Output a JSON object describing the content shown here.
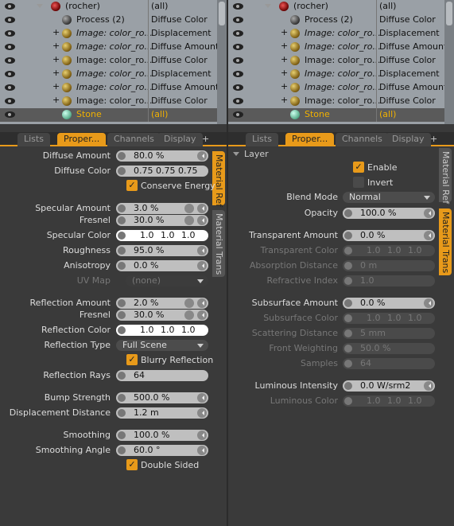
{
  "tree": {
    "rows": [
      {
        "name": "(rocher)",
        "effect": "(all)"
      },
      {
        "name": "Process (2)",
        "effect": "Diffuse Color"
      },
      {
        "name": "Image: color_ro...",
        "effect": "Displacement"
      },
      {
        "name": "Image: color_ro...",
        "effect": "Diffuse Amount"
      },
      {
        "name": "Image: color_ro...",
        "effect": "Diffuse Color"
      },
      {
        "name": "Image: color_ro...",
        "effect": "Displacement"
      },
      {
        "name": "Image: color_ro...",
        "effect": "Diffuse Amount"
      },
      {
        "name": "Image: color_ro...",
        "effect": "Diffuse Color"
      },
      {
        "name": "Stone",
        "effect": "(all)"
      }
    ]
  },
  "tabs": {
    "lists": "Lists",
    "properties": "Proper...",
    "channels": "Channels",
    "display": "Display",
    "add": "+"
  },
  "left": {
    "vtabs": {
      "material_ref": "Material Ref",
      "material_trans": "Material Trans"
    },
    "diffuse_amount": {
      "label": "Diffuse Amount",
      "value": "80.0 %"
    },
    "diffuse_color": {
      "label": "Diffuse Color",
      "value": "0.75 0.75 0.75"
    },
    "conserve_energy": {
      "label": "Conserve Energy",
      "check": "✓"
    },
    "specular_amount": {
      "label": "Specular Amount",
      "value": "3.0 %"
    },
    "fresnel": {
      "label": "Fresnel",
      "value": "30.0 %"
    },
    "specular_color": {
      "label": "Specular Color",
      "r": "1.0",
      "g": "1.0",
      "b": "1.0"
    },
    "roughness": {
      "label": "Roughness",
      "value": "95.0 %"
    },
    "anisotropy": {
      "label": "Anisotropy",
      "value": "0.0 %"
    },
    "uv_map": {
      "label": "UV Map",
      "value": "(none)"
    },
    "reflection_amount": {
      "label": "Reflection Amount",
      "value": "2.0 %"
    },
    "fresnel2": {
      "label": "Fresnel",
      "value": "30.0 %"
    },
    "reflection_color": {
      "label": "Reflection Color",
      "r": "1.0",
      "g": "1.0",
      "b": "1.0"
    },
    "reflection_type": {
      "label": "Reflection Type",
      "value": "Full Scene"
    },
    "blurry_reflection": {
      "label": "Blurry Reflection",
      "check": "✓"
    },
    "reflection_rays": {
      "label": "Reflection Rays",
      "value": "64"
    },
    "bump_strength": {
      "label": "Bump Strength",
      "value": "500.0 %"
    },
    "displacement_distance": {
      "label": "Displacement Distance",
      "value": "1.2 m"
    },
    "smoothing": {
      "label": "Smoothing",
      "value": "100.0 %"
    },
    "smoothing_angle": {
      "label": "Smoothing Angle",
      "value": "60.0 °"
    },
    "double_sided": {
      "label": "Double Sided",
      "check": "✓"
    }
  },
  "right": {
    "vtabs": {
      "material_ref": "Material Ref",
      "material_trans": "Material Trans"
    },
    "layer": "Layer",
    "enable": {
      "label": "Enable",
      "check": "✓"
    },
    "invert": {
      "label": "Invert"
    },
    "blend_mode": {
      "label": "Blend Mode",
      "value": "Normal"
    },
    "opacity": {
      "label": "Opacity",
      "value": "100.0 %"
    },
    "transparent_amount": {
      "label": "Transparent Amount",
      "value": "0.0 %"
    },
    "transparent_color": {
      "label": "Transparent Color",
      "r": "1.0",
      "g": "1.0",
      "b": "1.0"
    },
    "absorption_distance": {
      "label": "Absorption Distance",
      "value": "0 m"
    },
    "refractive_index": {
      "label": "Refractive Index",
      "value": "1.0"
    },
    "subsurface_amount": {
      "label": "Subsurface Amount",
      "value": "0.0 %"
    },
    "subsurface_color": {
      "label": "Subsurface Color",
      "r": "1.0",
      "g": "1.0",
      "b": "1.0"
    },
    "scattering_distance": {
      "label": "Scattering Distance",
      "value": "5 mm"
    },
    "front_weighting": {
      "label": "Front Weighting",
      "value": "50.0 %"
    },
    "samples": {
      "label": "Samples",
      "value": "64"
    },
    "luminous_intensity": {
      "label": "Luminous Intensity",
      "value": "0.0 W/srm2"
    },
    "luminous_color": {
      "label": "Luminous Color",
      "r": "1.0",
      "g": "1.0",
      "b": "1.0"
    }
  }
}
